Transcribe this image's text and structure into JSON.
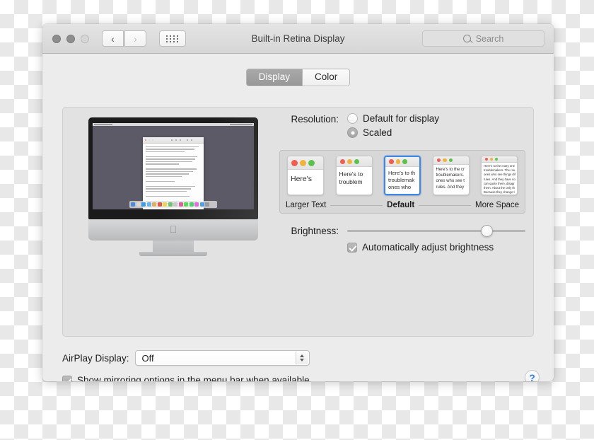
{
  "window": {
    "title": "Built-in Retina Display",
    "traffic_lights": [
      "close",
      "minimize",
      "zoom"
    ],
    "nav": {
      "back": "‹",
      "forward": "›"
    },
    "show_all_icon": "grid-icon",
    "search": {
      "placeholder": "Search",
      "icon": "search-icon",
      "value": ""
    }
  },
  "tabs": [
    {
      "label": "Display",
      "active": true
    },
    {
      "label": "Color",
      "active": false
    }
  ],
  "preview": {
    "device": "imac-illustration",
    "document_window": "text-document",
    "apple_logo": "",
    "dock_items": [
      "finder",
      "launchpad",
      "safari",
      "mail",
      "contacts",
      "calendar",
      "notes",
      "reminders",
      "maps",
      "photos",
      "messages",
      "facetime",
      "itunes",
      "appstore",
      "preferences",
      "trash"
    ],
    "dock_colors": [
      "#4e8cd8",
      "#d9d9d9",
      "#3f9ee0",
      "#6fb2e8",
      "#e0b060",
      "#e05a4a",
      "#e8d45a",
      "#6fc06f",
      "#c8c8c8",
      "#d95fa0",
      "#5ad95a",
      "#4fd06c",
      "#d96fd9",
      "#4f9fe8",
      "#9a9a9a",
      "#c4c4c4"
    ]
  },
  "resolution": {
    "label": "Resolution:",
    "options": [
      {
        "label": "Default for display",
        "selected": false
      },
      {
        "label": "Scaled",
        "selected": true
      }
    ]
  },
  "scaling": {
    "sample_text": "Here's to the crazy ones. The misfits. The rebels. The troublemakers. The round pegs in the square holes. The ones who see things differently. They're not fond of rules. And they have no respect for the status quo. You can quote them, disagree with them, glorify or vilify them. About the only thing you can't do is ignore them. Because they change things.",
    "thumbnails": [
      {
        "id": "larger-text",
        "selected": false,
        "scale": "xl",
        "lines": [
          "Here's"
        ]
      },
      {
        "id": "scale-2",
        "selected": false,
        "scale": "lg",
        "lines": [
          "Here's to",
          "troublem"
        ]
      },
      {
        "id": "default",
        "selected": true,
        "scale": "md",
        "lines": [
          "Here's to th",
          "troublemak",
          "ones who"
        ]
      },
      {
        "id": "scale-4",
        "selected": false,
        "scale": "sm",
        "lines": [
          "Here's to the cr",
          "troublemakers.",
          "ones who see t",
          "rules. And they"
        ]
      },
      {
        "id": "more-space",
        "selected": false,
        "scale": "xs",
        "lines": [
          "Here's to the crazy one",
          "troublemakers. The rou",
          "ones who see things dif",
          "rules. And they have no",
          "can quote them, disagr",
          "them. About the only th",
          "Because they change t"
        ]
      }
    ],
    "labels": {
      "left": "Larger Text",
      "center": "Default",
      "right": "More Space"
    }
  },
  "brightness": {
    "label": "Brightness:",
    "value_percent": 78,
    "auto_adjust": {
      "label": "Automatically adjust brightness",
      "checked": true
    }
  },
  "airplay": {
    "label": "AirPlay Display:",
    "value": "Off",
    "options": [
      "Off"
    ]
  },
  "mirroring": {
    "label": "Show mirroring options in the menu bar when available",
    "checked": true
  },
  "help": {
    "glyph": "?",
    "name": "help-button"
  },
  "colors": {
    "accent_blue": "#3f86e8",
    "help_blue": "#2d7ff0",
    "window_bg": "#ececec",
    "content_bg": "#e2e2e2",
    "scaling_bg": "#d7d7d7",
    "desktop": "#5b5a66",
    "traffic_gray": "#8e8e8e",
    "dot_red": "#ef5e52",
    "dot_yellow": "#f2b33d",
    "dot_green": "#5dc24b"
  }
}
